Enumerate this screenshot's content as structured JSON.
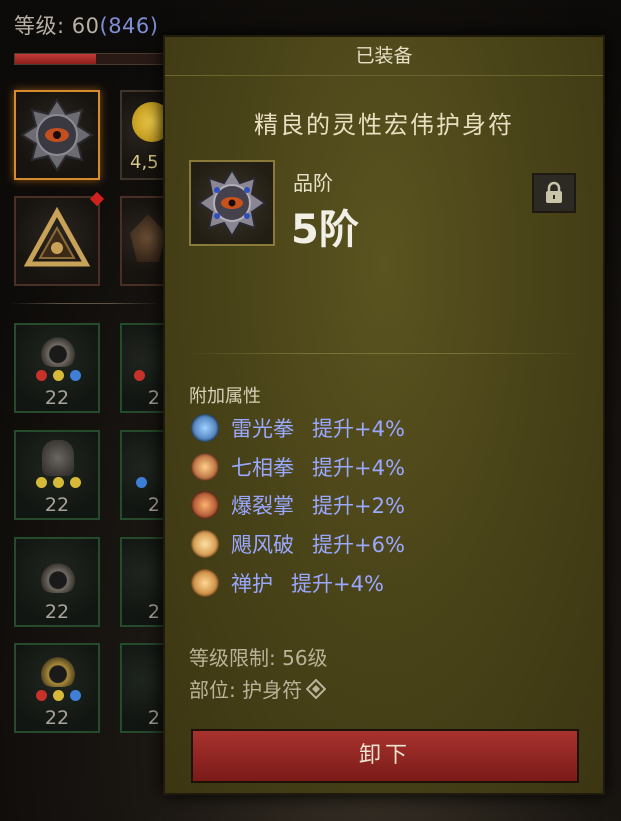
{
  "player": {
    "level_label": "等级:",
    "level": "60",
    "paragon": "(846)",
    "xp_progress": 0.55,
    "gold_partial": "4,5"
  },
  "inventory": {
    "gear_levels": [
      "22",
      "2",
      "22",
      "2",
      "22",
      "2",
      "22",
      "2"
    ]
  },
  "tooltip": {
    "header": "已装备",
    "item_name": "精良的灵性宏伟护身符",
    "grade_label": "品阶",
    "grade_value": "5阶",
    "attributes_title": "附加属性",
    "attributes": [
      {
        "skill": "雷光拳",
        "bonus": "提升+4%",
        "icon": "thunder-fist-icon",
        "color": "#2e6fb0"
      },
      {
        "skill": "七相拳",
        "bonus": "提升+4%",
        "icon": "seven-sided-strike-icon",
        "color": "#c2561c"
      },
      {
        "skill": "爆裂掌",
        "bonus": "提升+2%",
        "icon": "exploding-palm-icon",
        "color": "#b3421a"
      },
      {
        "skill": "飓风破",
        "bonus": "提升+6%",
        "icon": "cyclone-strike-icon",
        "color": "#d9862a"
      },
      {
        "skill": "禅护",
        "bonus": "提升+4%",
        "icon": "serenity-icon",
        "color": "#d17a22"
      }
    ],
    "level_requirement": "等级限制: 56级",
    "slot": "部位: 护身符",
    "unequip_label": "卸下"
  }
}
